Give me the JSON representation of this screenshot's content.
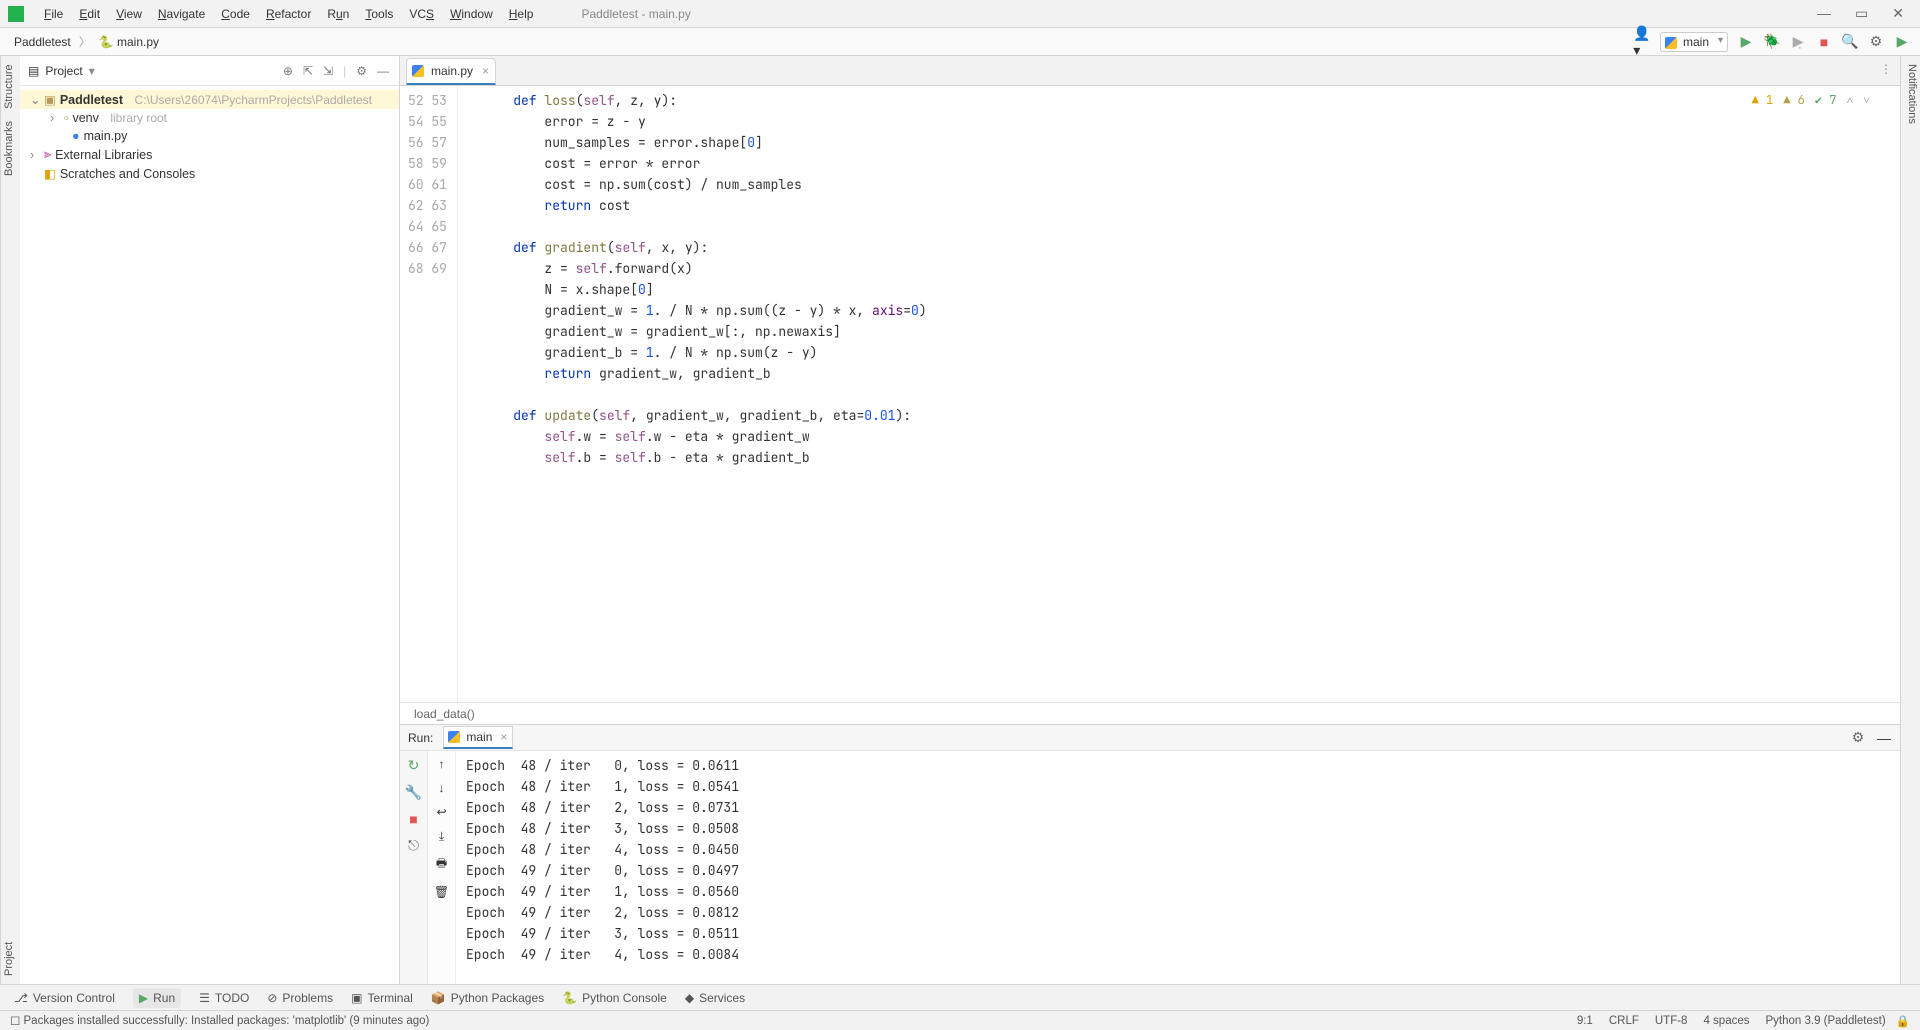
{
  "window": {
    "title": "Paddletest - main.py"
  },
  "menu": [
    "File",
    "Edit",
    "View",
    "Navigate",
    "Code",
    "Refactor",
    "Run",
    "Tools",
    "VCS",
    "Window",
    "Help"
  ],
  "breadcrumbs": {
    "project": "Paddletest",
    "file": "main.py"
  },
  "toolbar": {
    "run_config": "main"
  },
  "project_panel": {
    "title": "Project",
    "root": {
      "name": "Paddletest",
      "path": "C:\\Users\\26074\\PycharmProjects\\Paddletest"
    },
    "venv": {
      "name": "venv",
      "hint": "library root"
    },
    "file": "main.py",
    "external": "External Libraries",
    "scratches": "Scratches and Consoles"
  },
  "editor": {
    "tab": "main.py",
    "breadcrumb": "load_data()",
    "first_line": 52,
    "lines": [
      "    def loss(self, z, y):",
      "        error = z - y",
      "        num_samples = error.shape[0]",
      "        cost = error * error",
      "        cost = np.sum(cost) / num_samples",
      "        return cost",
      "",
      "    def gradient(self, x, y):",
      "        z = self.forward(x)",
      "        N = x.shape[0]",
      "        gradient_w = 1. / N * np.sum((z - y) * x, axis=0)",
      "        gradient_w = gradient_w[:, np.newaxis]",
      "        gradient_b = 1. / N * np.sum(z - y)",
      "        return gradient_w, gradient_b",
      "",
      "    def update(self, gradient_w, gradient_b, eta=0.01):",
      "        self.w = self.w - eta * gradient_w",
      "        self.b = self.b - eta * gradient_b"
    ],
    "inspections": {
      "warn": "1",
      "weak": "6",
      "typo": "7"
    }
  },
  "run": {
    "label": "Run:",
    "tab": "main",
    "output": [
      "Epoch  48 / iter   0, loss = 0.0611",
      "Epoch  48 / iter   1, loss = 0.0541",
      "Epoch  48 / iter   2, loss = 0.0731",
      "Epoch  48 / iter   3, loss = 0.0508",
      "Epoch  48 / iter   4, loss = 0.0450",
      "Epoch  49 / iter   0, loss = 0.0497",
      "Epoch  49 / iter   1, loss = 0.0560",
      "Epoch  49 / iter   2, loss = 0.0812",
      "Epoch  49 / iter   3, loss = 0.0511",
      "Epoch  49 / iter   4, loss = 0.0084"
    ]
  },
  "bottom_tabs": [
    "Version Control",
    "Run",
    "TODO",
    "Problems",
    "Terminal",
    "Python Packages",
    "Python Console",
    "Services"
  ],
  "status": {
    "message": "Packages installed successfully: Installed packages: 'matplotlib' (9 minutes ago)",
    "caret": "9:1",
    "eol": "CRLF",
    "encoding": "UTF-8",
    "indent": "4 spaces",
    "interpreter": "Python 3.9 (Paddletest)"
  },
  "left_labels": {
    "project": "Project",
    "bookmarks": "Bookmarks",
    "structure": "Structure"
  },
  "right_label": "Notifications"
}
